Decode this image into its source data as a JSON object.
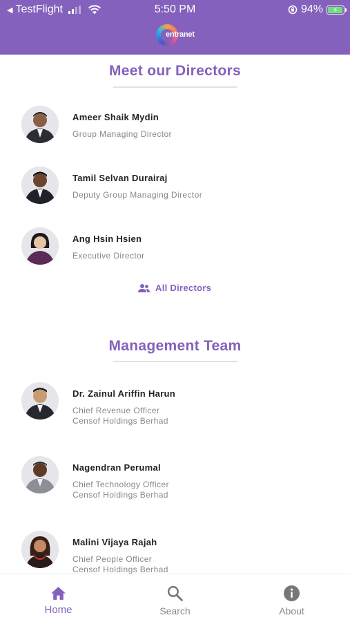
{
  "status_bar": {
    "back_app": "TestFlight",
    "time": "5:50 PM",
    "battery": "94%"
  },
  "header": {
    "logo_text": "entranet"
  },
  "directors": {
    "title": "Meet our Directors",
    "people": [
      {
        "name": "Ameer Shaik Mydin",
        "role": "Group Managing Director"
      },
      {
        "name": "Tamil Selvan Durairaj",
        "role": "Deputy Group Managing Director"
      },
      {
        "name": "Ang Hsin Hsien",
        "role": "Executive Director"
      }
    ],
    "all_label": "All Directors",
    "all_icon": "people-icon"
  },
  "management": {
    "title": "Management Team",
    "people": [
      {
        "name": "Dr. Zainul Ariffin Harun",
        "role": "Chief Revenue Officer",
        "org": "Censof Holdings Berhad"
      },
      {
        "name": "Nagendran Perumal",
        "role": "Chief Technology Officer",
        "org": "Censof Holdings Berhad"
      },
      {
        "name": "Malini Vijaya Rajah",
        "role": "Chief People Officer",
        "org": "Censof Holdings Berhad"
      }
    ]
  },
  "tabbar": {
    "tabs": [
      {
        "label": "Home",
        "icon": "home-icon",
        "active": true
      },
      {
        "label": "Search",
        "icon": "search-icon",
        "active": false
      },
      {
        "label": "About",
        "icon": "info-icon",
        "active": false
      }
    ]
  },
  "colors": {
    "brand": "#8461bd",
    "battery_fill": "#6ee07a",
    "muted_text": "#888888"
  }
}
